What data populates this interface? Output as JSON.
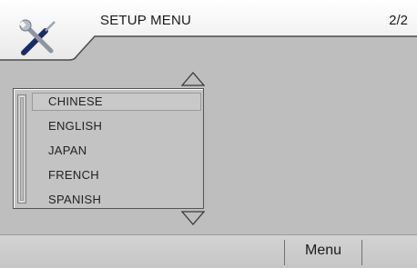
{
  "header": {
    "title": "SETUP MENU",
    "page_indicator": "2/2",
    "icon": "tools-icon"
  },
  "language_list": {
    "items": [
      {
        "label": "CHINESE",
        "selected": true
      },
      {
        "label": "ENGLISH",
        "selected": false
      },
      {
        "label": "JAPAN",
        "selected": false
      },
      {
        "label": "FRENCH",
        "selected": false
      },
      {
        "label": "SPANISH",
        "selected": false
      }
    ],
    "scroll_up_icon": "triangle-up-icon",
    "scroll_down_icon": "triangle-down-icon"
  },
  "footer": {
    "menu_label": "Menu"
  },
  "colors": {
    "background": "#bebebe",
    "header_white": "#ffffff",
    "text": "#1a1a1a"
  }
}
